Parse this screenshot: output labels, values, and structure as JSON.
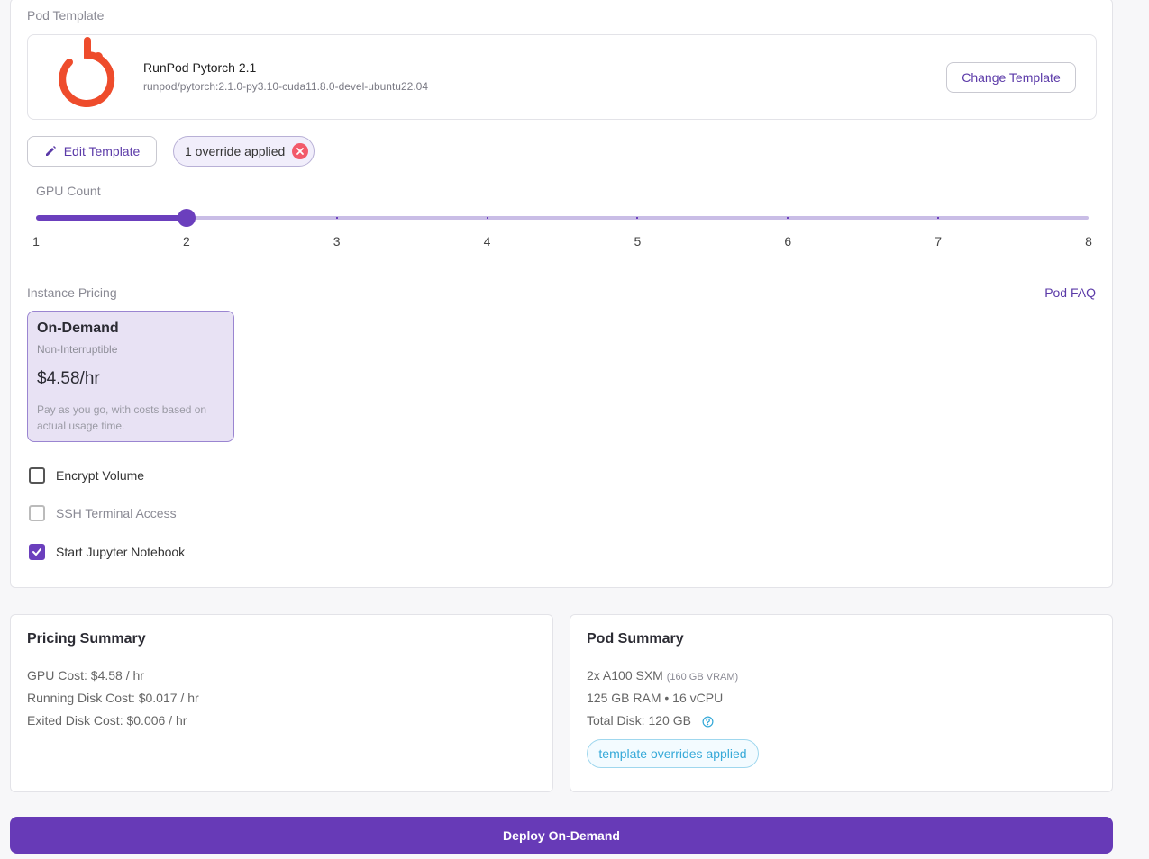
{
  "pod_template": {
    "section_label": "Pod Template",
    "name": "RunPod Pytorch 2.1",
    "image": "runpod/pytorch:2.1.0-py3.10-cuda11.8.0-devel-ubuntu22.04",
    "change_label": "Change Template",
    "logo_icon": "pytorch-logo",
    "logo_color": "#ee4c2c"
  },
  "actions": {
    "edit_label": "Edit Template",
    "override_label": "1 override applied"
  },
  "gpu_count": {
    "label": "GPU Count",
    "min": 1,
    "max": 8,
    "value": 2,
    "ticks": [
      "1",
      "2",
      "3",
      "4",
      "5",
      "6",
      "7",
      "8"
    ]
  },
  "instance_pricing": {
    "label": "Instance Pricing",
    "faq_label": "Pod FAQ",
    "option": {
      "title": "On-Demand",
      "subtitle": "Non-Interruptible",
      "price": "$4.58/hr",
      "description": "Pay as you go, with costs based on actual usage time."
    }
  },
  "options": [
    {
      "label": "Encrypt Volume",
      "checked": false,
      "disabled": false
    },
    {
      "label": "SSH Terminal Access",
      "checked": false,
      "disabled": true
    },
    {
      "label": "Start Jupyter Notebook",
      "checked": true,
      "disabled": false
    }
  ],
  "pricing_summary": {
    "title": "Pricing Summary",
    "lines": [
      "GPU Cost: $4.58 / hr",
      "Running Disk Cost: $0.017 / hr",
      "Exited Disk Cost: $0.006 / hr"
    ]
  },
  "pod_summary": {
    "title": "Pod Summary",
    "gpu": "2x A100 SXM",
    "vram": "(160 GB VRAM)",
    "specs": "125 GB RAM • 16 vCPU",
    "disk": "Total Disk: 120 GB",
    "overrides_chip": "template overrides applied"
  },
  "deploy_label": "Deploy On-Demand",
  "colors": {
    "accent": "#673ab7",
    "danger": "#f25a6a",
    "info": "#36a9d8"
  }
}
